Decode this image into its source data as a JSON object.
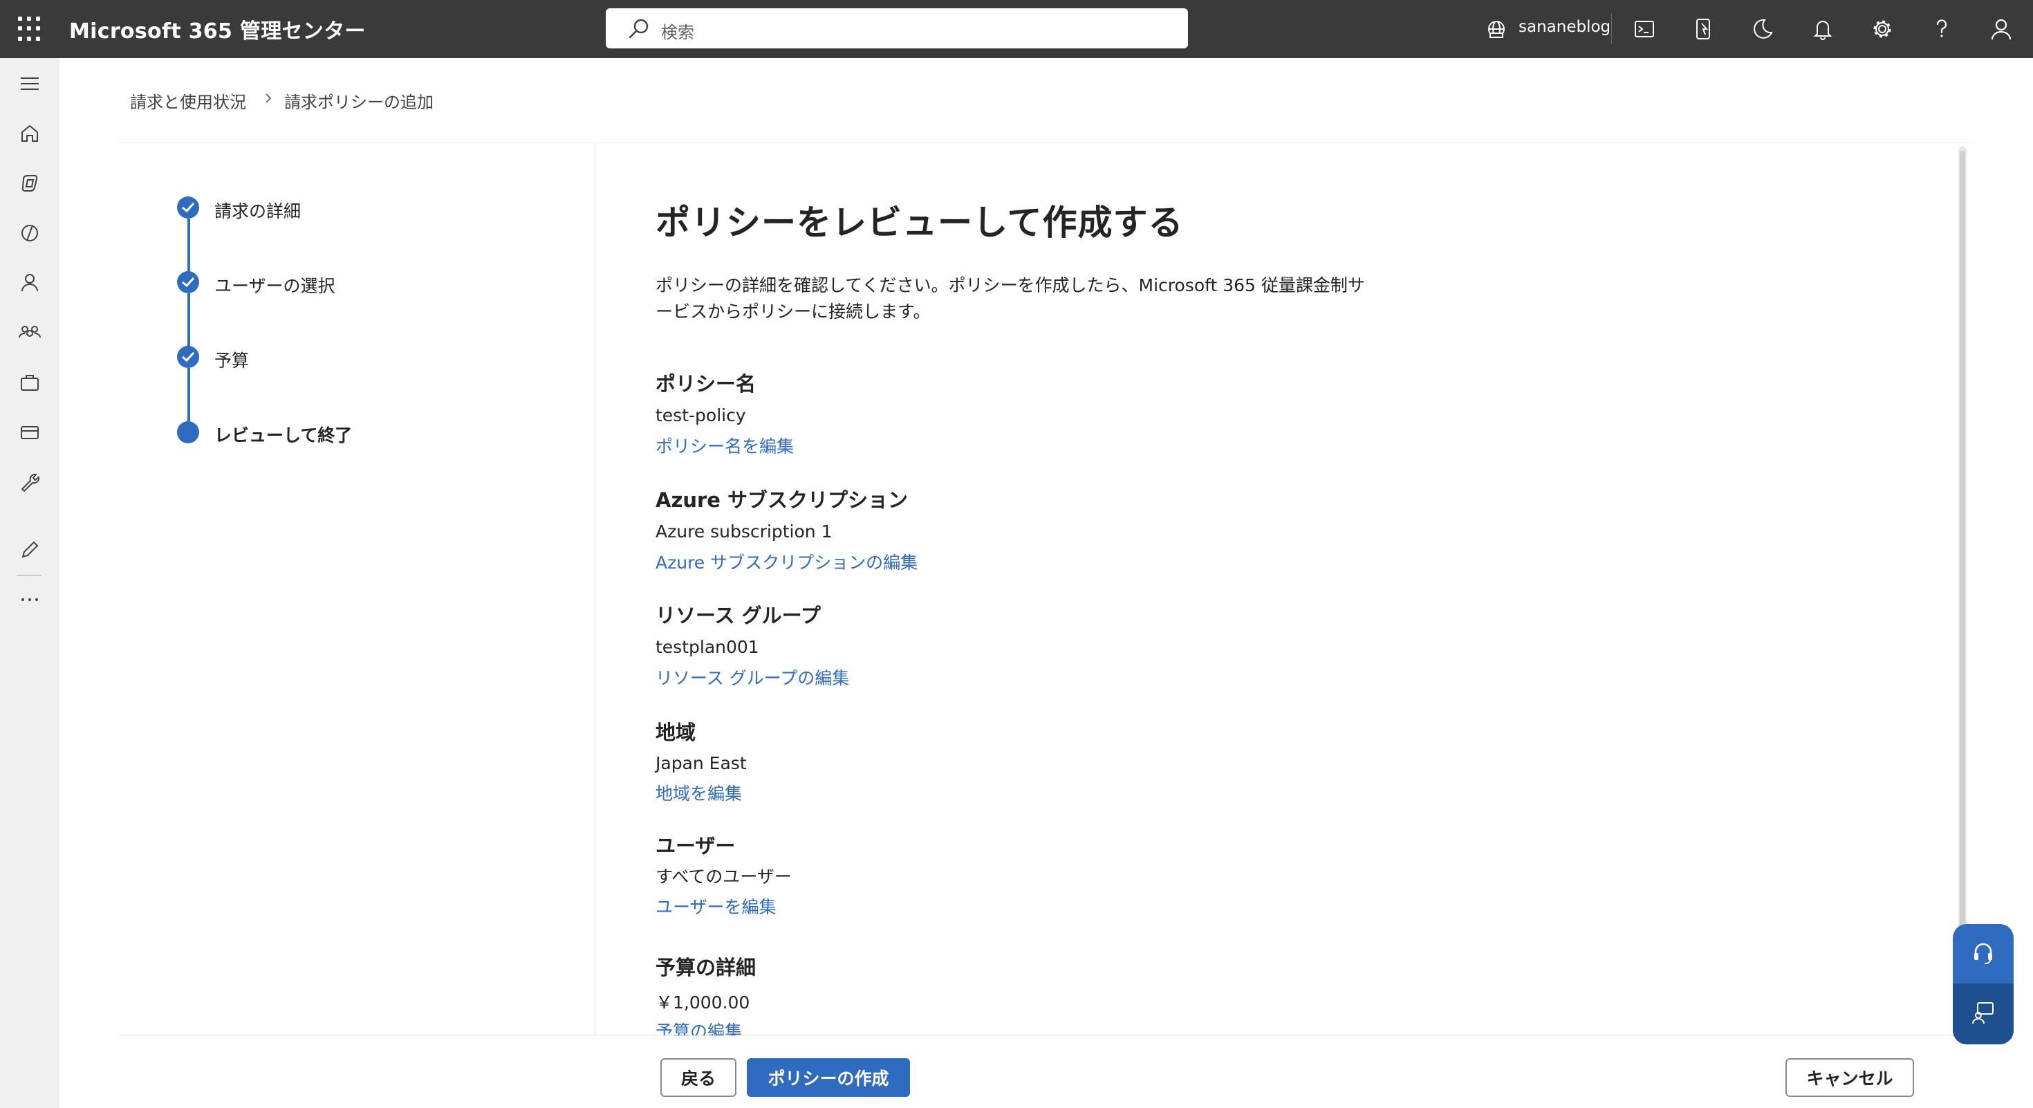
{
  "header": {
    "app_title": "Microsoft 365 管理センター",
    "search_placeholder": "検索",
    "org_name": "sananeblog"
  },
  "breadcrumb": {
    "items": [
      "請求と使用状況",
      "請求ポリシーの追加"
    ]
  },
  "wizard": {
    "steps": [
      {
        "label": "請求の詳細",
        "state": "completed"
      },
      {
        "label": "ユーザーの選択",
        "state": "completed"
      },
      {
        "label": "予算",
        "state": "completed"
      },
      {
        "label": "レビューして終了",
        "state": "current"
      }
    ]
  },
  "main": {
    "title": "ポリシーをレビューして作成する",
    "description_line1": "ポリシーの詳細を確認してください。ポリシーを作成したら、Microsoft 365 従量課金制サ",
    "description_line2": "ービスからポリシーに接続します。",
    "sections": [
      {
        "heading": "ポリシー名",
        "value": "test-policy",
        "link": "ポリシー名を編集"
      },
      {
        "heading": "Azure サブスクリプション",
        "value": "Azure subscription 1",
        "link": "Azure サブスクリプションの編集"
      },
      {
        "heading": "リソース グループ",
        "value": "testplan001",
        "link": "リソース グループの編集"
      },
      {
        "heading": "地域",
        "value": "Japan East",
        "link": "地域を編集"
      },
      {
        "heading": "ユーザー",
        "value": "すべてのユーザー",
        "link": "ユーザーを編集"
      },
      {
        "heading": "予算の詳細",
        "value": "￥1,000.00",
        "link": "予算の編集"
      }
    ]
  },
  "footer": {
    "back_label": "戻る",
    "create_label": "ポリシーの作成",
    "cancel_label": "キャンセル"
  },
  "colors": {
    "topbar": "#3a3a3a",
    "accent": "#2f6bbf",
    "rail": "#f0f0f0"
  },
  "icons": {
    "topbar": [
      "org-globe-icon",
      "terminal-icon",
      "mobile-app-icon",
      "dark-mode-icon",
      "notification-bell-icon",
      "settings-gear-icon",
      "help-question-icon",
      "user-account-icon"
    ],
    "rail": [
      "hamburger-menu-icon",
      "home-icon",
      "copilot-icon",
      "viva-icon",
      "user-icon",
      "teams-icon",
      "briefcase-icon",
      "billing-card-icon",
      "wrench-icon",
      "edit-pencil-icon",
      "more-ellipsis-icon"
    ],
    "floating": [
      "support-headset-icon",
      "feedback-chat-icon"
    ]
  }
}
